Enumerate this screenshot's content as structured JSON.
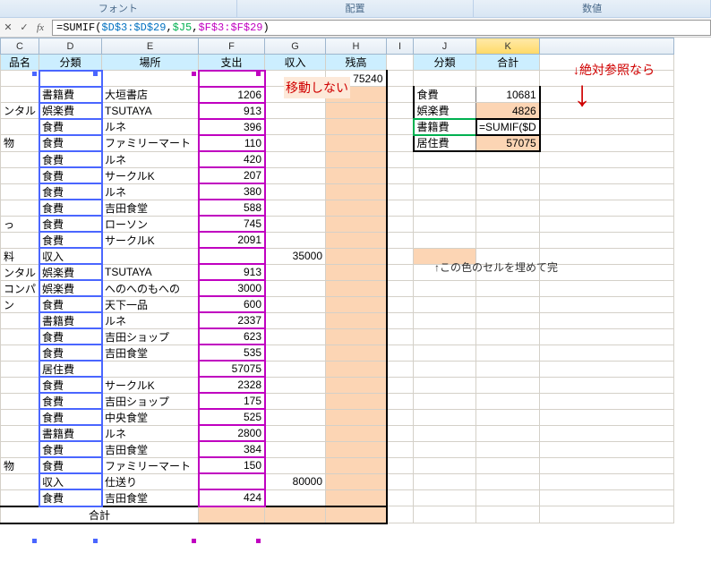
{
  "ribbon": {
    "font": "フォント",
    "align": "配置",
    "number": "数値"
  },
  "formula_bar": {
    "cancel": "✕",
    "enter": "✓",
    "fx": "fx",
    "p0": "=SUMIF(",
    "p1": "$D$3:$D$29",
    "p2": ",",
    "p3": "$J5",
    "p4": ",",
    "p5": "$F$3:$F$29",
    "p6": ")"
  },
  "headers": {
    "C": "品名",
    "D": "分類",
    "E": "場所",
    "F": "支出",
    "G": "収入",
    "H": "残高",
    "J": "分類",
    "K": "合計"
  },
  "rows": [
    {
      "c": "",
      "d": "",
      "e": "",
      "f": "",
      "g": "",
      "h": "75240"
    },
    {
      "c": "",
      "d": "書籍費",
      "e": "大垣書店",
      "f": "1206",
      "g": "",
      "h": ""
    },
    {
      "c": "ンタル",
      "d": "娯楽費",
      "e": "TSUTAYA",
      "f": "913",
      "g": "",
      "h": ""
    },
    {
      "c": "",
      "d": "食費",
      "e": "ルネ",
      "f": "396",
      "g": "",
      "h": ""
    },
    {
      "c": "物",
      "d": "食費",
      "e": "ファミリーマート",
      "f": "110",
      "g": "",
      "h": ""
    },
    {
      "c": "",
      "d": "食費",
      "e": "ルネ",
      "f": "420",
      "g": "",
      "h": ""
    },
    {
      "c": "",
      "d": "食費",
      "e": "サークルK",
      "f": "207",
      "g": "",
      "h": ""
    },
    {
      "c": "",
      "d": "食費",
      "e": "ルネ",
      "f": "380",
      "g": "",
      "h": ""
    },
    {
      "c": "",
      "d": "食費",
      "e": "吉田食堂",
      "f": "588",
      "g": "",
      "h": ""
    },
    {
      "c": "っ",
      "d": "食費",
      "e": "ローソン",
      "f": "745",
      "g": "",
      "h": ""
    },
    {
      "c": "",
      "d": "食費",
      "e": "サークルK",
      "f": "2091",
      "g": "",
      "h": ""
    },
    {
      "c": "料",
      "d": "収入",
      "e": "",
      "f": "",
      "g": "35000",
      "h": ""
    },
    {
      "c": "ンタル",
      "d": "娯楽費",
      "e": "TSUTAYA",
      "f": "913",
      "g": "",
      "h": ""
    },
    {
      "c": "コンパ",
      "d": "娯楽費",
      "e": "へのへのもへの",
      "f": "3000",
      "g": "",
      "h": ""
    },
    {
      "c": "ン",
      "d": "食費",
      "e": "天下一品",
      "f": "600",
      "g": "",
      "h": ""
    },
    {
      "c": "",
      "d": "書籍費",
      "e": "ルネ",
      "f": "2337",
      "g": "",
      "h": ""
    },
    {
      "c": "",
      "d": "食費",
      "e": "吉田ショップ",
      "f": "623",
      "g": "",
      "h": ""
    },
    {
      "c": "",
      "d": "食費",
      "e": "吉田食堂",
      "f": "535",
      "g": "",
      "h": ""
    },
    {
      "c": "",
      "d": "居住費",
      "e": "",
      "f": "57075",
      "g": "",
      "h": ""
    },
    {
      "c": "",
      "d": "食費",
      "e": "サークルK",
      "f": "2328",
      "g": "",
      "h": ""
    },
    {
      "c": "",
      "d": "食費",
      "e": "吉田ショップ",
      "f": "175",
      "g": "",
      "h": ""
    },
    {
      "c": "",
      "d": "食費",
      "e": "中央食堂",
      "f": "525",
      "g": "",
      "h": ""
    },
    {
      "c": "",
      "d": "書籍費",
      "e": "ルネ",
      "f": "2800",
      "g": "",
      "h": ""
    },
    {
      "c": "",
      "d": "食費",
      "e": "吉田食堂",
      "f": "384",
      "g": "",
      "h": ""
    },
    {
      "c": "物",
      "d": "食費",
      "e": "ファミリーマート",
      "f": "150",
      "g": "",
      "h": ""
    },
    {
      "c": "",
      "d": "収入",
      "e": "仕送り",
      "f": "",
      "g": "80000",
      "h": ""
    },
    {
      "c": "",
      "d": "食費",
      "e": "吉田食堂",
      "f": "424",
      "g": "",
      "h": ""
    }
  ],
  "total_label": "合計",
  "summary": [
    {
      "cat": "食費",
      "val": "10681"
    },
    {
      "cat": "娯楽費",
      "val": "4826"
    },
    {
      "cat": "書籍費",
      "val": "=SUMIF($D"
    },
    {
      "cat": "居住費",
      "val": "57075"
    }
  ],
  "annot": {
    "no_move": "移動しない",
    "arrow": "↓絶対参照なら",
    "fill_note": "↑この色のセルを埋めて完"
  }
}
